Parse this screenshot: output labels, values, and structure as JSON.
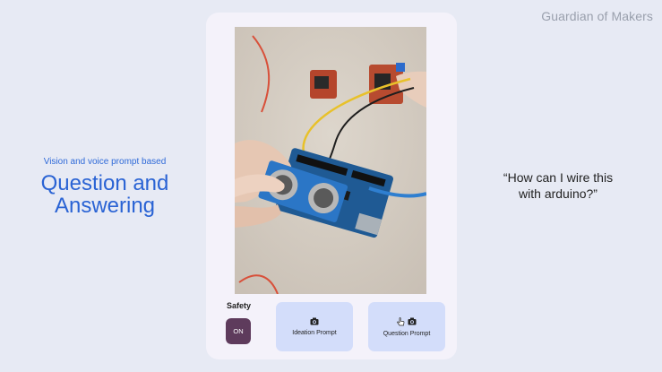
{
  "brand": "Guardian of Makers",
  "left": {
    "subtitle": "Vision and voice prompt based",
    "title_line1": "Question and",
    "title_line2": "Answering"
  },
  "quote": {
    "line1": "“How can I wire this",
    "line2": "with arduino?”"
  },
  "panel": {
    "safety_label": "Safety",
    "toggle_label": "ON",
    "ideation_label": "Ideation Prompt",
    "question_label": "Question Prompt"
  },
  "icons": {
    "ideation": "camera-icon",
    "question_pointer": "hand-pointer-icon",
    "question": "camera-icon"
  },
  "colors": {
    "accent": "#2a63d4",
    "toggle_on": "#5e3b5c",
    "button_bg": "#d3ddfa",
    "panel_bg": "#f4f2fa"
  }
}
